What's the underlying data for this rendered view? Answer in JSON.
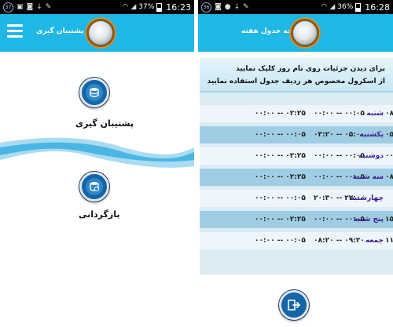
{
  "left": {
    "status": {
      "badge": "37",
      "battery": "37%",
      "time": "16:23"
    },
    "title": "صفحه پشتیبان گیری",
    "backup_label": "پشتیبان گیری",
    "restore_label": "بازگردانی"
  },
  "right": {
    "status": {
      "badge": "36",
      "battery": "36%",
      "time": "16:28"
    },
    "title": "صفحه جدول هفته",
    "info_line1": "برای دیدن جزئیات روی نام روز کلیک نمایید",
    "info_line2": "از اسکرول مخصوص هر ردیف جدول استفاده نمایید",
    "rows": [
      {
        "day": "شنبه",
        "c1": "۰۰:۰۰ -- ۰۲:۲۵",
        "c2": "۰۰:۰۰ -- ۰۰:۰۵",
        "c3": "۰۸:"
      },
      {
        "day": "یکشنبه",
        "c1": "۰۰:۰۰ -- ۰۰:۰۵",
        "c2": "۰۳:۲۰ -- ۰۵:۰۰",
        "c3": "۰۵:"
      },
      {
        "day": "دوشنبه",
        "c1": "۰۰:۰۰ -- ۰۲:۲۵",
        "c2": "۰۰:۰۰ -- ۰۰:۰۵",
        "c3": "۰۰:"
      },
      {
        "day": "سه شنبه",
        "c1": "۰۰:۰۰ -- ۰۲:۲۵",
        "c2": "۰۰:۰۰ -- ۰۰:۰۵",
        "c3": "۰۸:"
      },
      {
        "day": "چهارشنبه",
        "c1": "۰۰:۰۰ -- ۰۰:۰۵",
        "c2": "۲۰:۳۰ -- ۲۲:۰۰",
        "c3": ""
      },
      {
        "day": "پنج شنبه",
        "c1": "۰۰:۰۰ -- ۰۲:۲۵",
        "c2": "۰۰:۰۰ -- ۰۰:۰۵",
        "c3": "۱۵:"
      },
      {
        "day": "جمعه",
        "c1": "۰۰:۰۰ -- ۰۰:۰۵",
        "c2": "۰۸:۲۰ -- ۰۹:۲۰",
        "c3": "۱۱"
      }
    ]
  },
  "colors": {
    "appbar": "#1fb7e6",
    "button": "#1565a8",
    "row_alt": "#9fcde3",
    "day_text": "#3a1c8c"
  },
  "icons": [
    "mirror-logo-icon",
    "hamburger-menu-icon",
    "database-backup-icon",
    "database-restore-icon",
    "exit-icon"
  ]
}
